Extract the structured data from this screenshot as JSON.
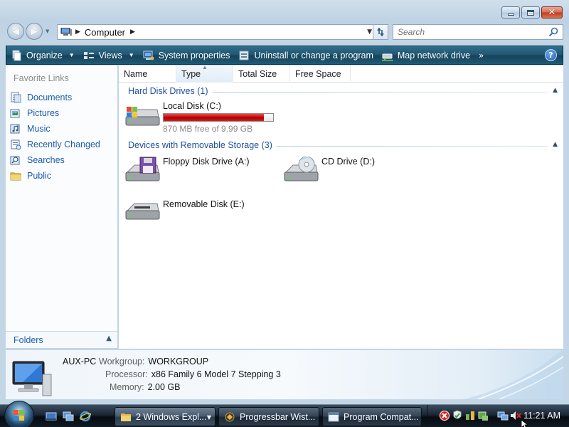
{
  "window": {
    "caption": {
      "minimize": "minimize",
      "maximize": "maximize",
      "close": "close"
    }
  },
  "address": {
    "crumb": "Computer",
    "search_placeholder": "Search"
  },
  "toolbar": {
    "items": [
      {
        "label": "Organize",
        "icon": "organize-icon",
        "dropdown": true
      },
      {
        "label": "Views",
        "icon": "views-icon",
        "dropdown": true
      },
      {
        "label": "System properties",
        "icon": "system-properties-icon"
      },
      {
        "label": "Uninstall or change a program",
        "icon": "uninstall-icon"
      },
      {
        "label": "Map network drive",
        "icon": "network-drive-icon"
      }
    ],
    "more": "»",
    "help": "?"
  },
  "nav": {
    "title": "Favorite Links",
    "items": [
      {
        "label": "Documents",
        "icon": "documents-icon"
      },
      {
        "label": "Pictures",
        "icon": "pictures-icon"
      },
      {
        "label": "Music",
        "icon": "music-icon"
      },
      {
        "label": "Recently Changed",
        "icon": "recently-changed-icon"
      },
      {
        "label": "Searches",
        "icon": "searches-icon"
      },
      {
        "label": "Public",
        "icon": "public-folder-icon"
      }
    ],
    "folders": "Folders"
  },
  "columns": [
    "Name",
    "Type",
    "Total Size",
    "Free Space"
  ],
  "groups": {
    "hard": {
      "label": "Hard Disk Drives (1)",
      "drives": [
        {
          "name": "Local Disk (C:)",
          "free": "870 MB free of 9.99 GB",
          "used_fraction": 0.915
        }
      ]
    },
    "removable": {
      "label": "Devices with Removable Storage (3)",
      "drives": [
        {
          "name": "Floppy Disk Drive (A:)",
          "icon": "floppy-drive-icon"
        },
        {
          "name": "CD Drive (D:)",
          "icon": "cd-drive-icon"
        },
        {
          "name": "Removable Disk (E:)",
          "icon": "removable-disk-icon"
        }
      ]
    }
  },
  "details": {
    "pc_name": "AUX-PC",
    "workgroup_key": "Workgroup:",
    "workgroup_val": "WORKGROUP",
    "processor_key": "Processor:",
    "processor_val": "x86 Family 6 Model 7 Stepping 3",
    "memory_key": "Memory:",
    "memory_val": "2.00 GB"
  },
  "taskbar": {
    "tasks": [
      {
        "label": "2 Windows Expl...",
        "active": true
      },
      {
        "label": "Progressbar Wist..."
      },
      {
        "label": "Program Compat..."
      }
    ],
    "clock": "11:21 AM"
  },
  "colors": {
    "link": "#1f5dab",
    "capacity_fill": "#c50000",
    "toolbar": "#22566f"
  }
}
